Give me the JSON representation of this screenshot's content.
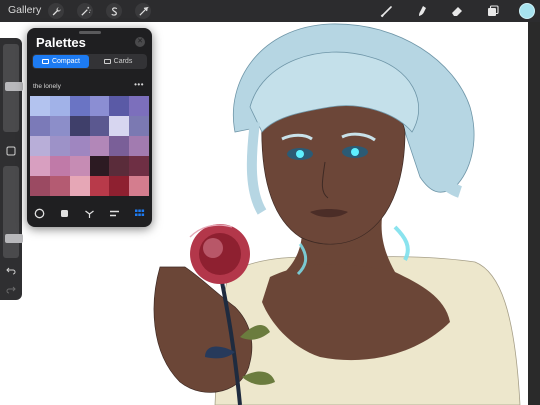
{
  "topbar": {
    "gallery_label": "Gallery",
    "left_tools": [
      "wrench-icon",
      "magic-wand-icon",
      "selection-s-icon",
      "transform-arrow-icon"
    ],
    "right_tools": [
      "brush-icon",
      "smudge-icon",
      "eraser-icon",
      "layers-icon"
    ],
    "current_color": "#a7e3ef"
  },
  "palette": {
    "title": "Palettes",
    "view_modes": {
      "compact_label": "Compact",
      "cards_label": "Cards",
      "selected": "Compact"
    },
    "palette_name": "the lonely",
    "more_label": "•••",
    "swatches": [
      "#b3c3ef",
      "#a1b2e8",
      "#6a74c4",
      "#8b8ed3",
      "#5a5aa6",
      "#7c6fbc",
      "#7b7ab8",
      "#8c8ec9",
      "#3f3f6a",
      "#5b5890",
      "#d7d6f0",
      "#7b79b2",
      "#b8aed8",
      "#9d92c8",
      "#9f86c0",
      "#b287b8",
      "#7a5f98",
      "#a27bb0",
      "#d89fc0",
      "#c07aa8",
      "#c68cb4",
      "#2c1a22",
      "#5a2c3a",
      "#6e2f44",
      "#9b4a62",
      "#b45b72",
      "#e6a7b6",
      "#b83a4a",
      "#8e2030",
      "#d47d8e"
    ],
    "bottom_tabs": [
      "disc-icon",
      "square-icon",
      "harmony-icon",
      "value-icon",
      "palettes-grid-icon"
    ],
    "active_tab": "palettes-grid-icon"
  },
  "sidebar": {
    "brush_size_level": 0.25,
    "opacity_level": 0.88,
    "buttons": [
      "modify-square-icon",
      "undo-icon",
      "redo-icon"
    ]
  },
  "colors": {
    "accent": "#1d7bf2",
    "panel_bg": "#1f1f21",
    "toolbar_bg": "#2c2c2e"
  }
}
